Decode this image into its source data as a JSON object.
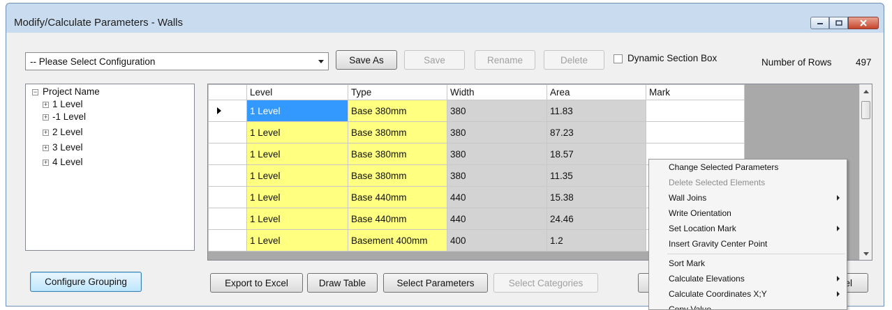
{
  "window": {
    "title": "Modify/Calculate Parameters - Walls"
  },
  "toolbar": {
    "config_value": "-- Please Select Configuration",
    "save_as": "Save As",
    "save": "Save",
    "rename": "Rename",
    "delete": "Delete",
    "dynamic_section_box": "Dynamic Section Box",
    "rows_label": "Number of Rows",
    "rows_value": "497"
  },
  "tree": {
    "root": "Project Name",
    "items": [
      "1 Level",
      "-1 Level",
      "2 Level",
      "3 Level",
      "4 Level"
    ]
  },
  "grid": {
    "columns": [
      "Level",
      "Type",
      "Width",
      "Area",
      "Mark"
    ],
    "rows": [
      [
        "1 Level",
        "Base 380mm",
        "380",
        "11.83",
        ""
      ],
      [
        "1 Level",
        "Base 380mm",
        "380",
        "87.23",
        ""
      ],
      [
        "1 Level",
        "Base 380mm",
        "380",
        "18.57",
        ""
      ],
      [
        "1 Level",
        "Base 380mm",
        "380",
        "11.35",
        ""
      ],
      [
        "1 Level",
        "Base 440mm",
        "440",
        "15.38",
        ""
      ],
      [
        "1 Level",
        "Base 440mm",
        "440",
        "24.46",
        ""
      ],
      [
        "1 Level",
        "Basement 400mm",
        "400",
        "1.2",
        ""
      ]
    ]
  },
  "bottom": {
    "configure_grouping": "Configure Grouping",
    "export_excel": "Export to Excel",
    "draw_table": "Draw Table",
    "select_parameters": "Select Parameters",
    "select_categories": "Select Categories",
    "cancel_partial": "el"
  },
  "context_menu": {
    "items": [
      {
        "label": "Change Selected Parameters",
        "disabled": false,
        "submenu": false
      },
      {
        "label": "Delete Selected Elements",
        "disabled": true,
        "submenu": false
      },
      {
        "label": "Wall Joins",
        "disabled": false,
        "submenu": true
      },
      {
        "label": "Write Orientation",
        "disabled": false,
        "submenu": false
      },
      {
        "label": "Set Location Mark",
        "disabled": false,
        "submenu": true
      },
      {
        "label": "Insert Gravity Center Point",
        "disabled": false,
        "submenu": false
      },
      {
        "label": "Sort Mark",
        "disabled": false,
        "submenu": false
      },
      {
        "label": "Calculate Elevations",
        "disabled": false,
        "submenu": true
      },
      {
        "label": "Calculate Coordinates X;Y",
        "disabled": false,
        "submenu": true
      },
      {
        "label": "Copy Value",
        "disabled": false,
        "submenu": false
      }
    ]
  }
}
